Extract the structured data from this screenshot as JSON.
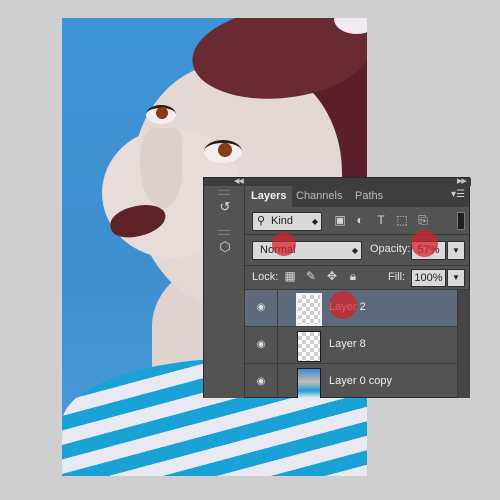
{
  "colors": {
    "background": "#cfcfcf",
    "panel": "#535353",
    "selected_row": "#5d6a7c",
    "annotation": "#d61e28",
    "photo_backdrop": "#3d95d6"
  },
  "layers_panel": {
    "tabs": [
      {
        "label": "Layers",
        "active": true
      },
      {
        "label": "Channels",
        "active": false
      },
      {
        "label": "Paths",
        "active": false
      }
    ],
    "filter": {
      "kind_label": "Kind",
      "icons": [
        "image-filter-icon",
        "adjustment-filter-icon",
        "type-filter-icon",
        "shape-filter-icon",
        "smart-object-filter-icon"
      ]
    },
    "blend_mode": "Normal",
    "opacity_label": "Opacity:",
    "opacity_value": "57%",
    "lock_label": "Lock:",
    "lock_icons": [
      "lock-transparent-icon",
      "lock-pixels-icon",
      "lock-position-icon",
      "lock-all-icon"
    ],
    "fill_label": "Fill:",
    "fill_value": "100%",
    "layers": [
      {
        "name": "Layer 2",
        "visible": true,
        "selected": true
      },
      {
        "name": "Layer 8",
        "visible": true,
        "selected": false
      },
      {
        "name": "Layer 0 copy",
        "visible": true,
        "selected": false
      }
    ]
  },
  "annotations": [
    "blend-mode",
    "opacity",
    "layer-2"
  ]
}
